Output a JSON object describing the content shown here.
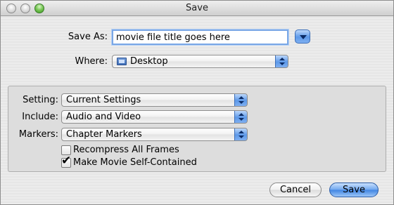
{
  "window": {
    "title": "Save"
  },
  "save_as": {
    "label": "Save As:",
    "value": "movie file title goes here"
  },
  "where": {
    "label": "Where:",
    "value": "Desktop"
  },
  "options": {
    "setting": {
      "label": "Setting:",
      "value": "Current Settings"
    },
    "include": {
      "label": "Include:",
      "value": "Audio and Video"
    },
    "markers": {
      "label": "Markers:",
      "value": "Chapter Markers"
    },
    "recompress": {
      "label": "Recompress All Frames",
      "checked": false
    },
    "self_contained": {
      "label": "Make Movie Self-Contained",
      "checked": true,
      "mark": "✔"
    }
  },
  "buttons": {
    "cancel": "Cancel",
    "save": "Save"
  },
  "colors": {
    "accent": "#5c98e8",
    "focus_ring": "#7aa7e6"
  }
}
